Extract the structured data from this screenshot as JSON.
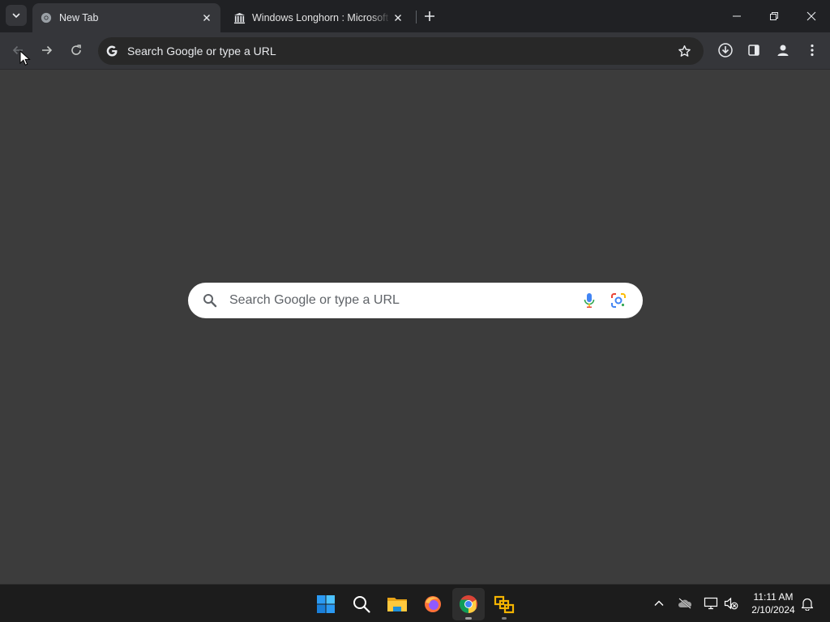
{
  "browser": {
    "tabs": [
      {
        "title": "New Tab",
        "active": true,
        "favicon": "chrome-icon"
      },
      {
        "title": "Windows Longhorn : Microsoft",
        "active": false,
        "favicon": "archive-icon"
      }
    ],
    "omnibox": {
      "placeholder": "Search Google or type a URL",
      "icon": "google-g-icon"
    },
    "window_controls": [
      "minimize-icon",
      "restore-icon",
      "close-icon"
    ],
    "toolbar_icons": [
      "back-icon",
      "forward-icon",
      "reload-icon",
      "star-icon",
      "download-icon",
      "side-panel-icon",
      "profile-icon",
      "menu-icon"
    ]
  },
  "ntp": {
    "search_placeholder": "Search Google or type a URL",
    "icons": [
      "search-icon",
      "microphone-icon",
      "google-lens-icon"
    ]
  },
  "taskbar": {
    "apps": [
      "windows-start-icon",
      "search-icon",
      "file-explorer-icon",
      "firefox-icon",
      "chrome-icon",
      "vmware-icon"
    ],
    "clock": {
      "time": "11:11 AM",
      "date": "2/10/2024"
    },
    "tray": [
      "chevron-up-icon",
      "onedrive-icon",
      "network-icon",
      "volume-muted-icon",
      "notification-bell-icon"
    ]
  },
  "colors": {
    "tabstrip": "#202124",
    "toolbar": "#35363a",
    "content": "#3c3c3c",
    "taskbar": "#1c1c1c",
    "search_box": "#ffffff"
  }
}
